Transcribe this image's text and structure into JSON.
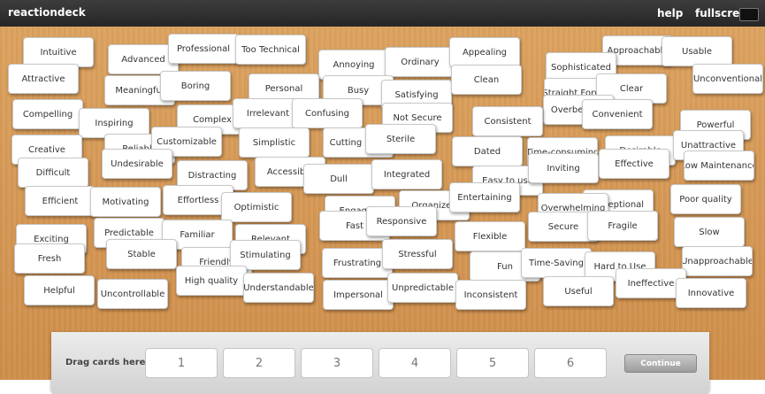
{
  "app": {
    "logo": "reactiondeck",
    "help_label": "help",
    "fullscreen_label": "fullscreen",
    "fullscreen_icon": "fullscreen-toggle-icon"
  },
  "cards": [
    "Intuitive",
    "Attractive",
    "Advanced",
    "Professional",
    "Too Technical",
    "Annoying",
    "Ordinary",
    "Appealing",
    "Approachable",
    "Usable",
    "Sophisticated",
    "Unconventional",
    "Meaningful",
    "Boring",
    "Busy",
    "Personal",
    "Satisfying",
    "Clean",
    "Straight Forward",
    "Clear",
    "Compelling",
    "Inspiring",
    "Complex",
    "Irrelevant",
    "Confusing",
    "Not Secure",
    "Overbearing",
    "Convenient",
    "Consistent",
    "Powerful",
    "Creative",
    "Reliable",
    "Customizable",
    "Simplistic",
    "Cutting edge",
    "Sterile",
    "Dated",
    "Time-consuming",
    "Desirable",
    "Unattractive",
    "Difficult",
    "Undesirable",
    "Distracting",
    "Accessible",
    "Dull",
    "Integrated",
    "Easy to use",
    "Inviting",
    "Effective",
    "Low Maintenance",
    "Efficient",
    "Motivating",
    "Effortless",
    "Optimistic",
    "Engaging",
    "Organized",
    "Entertaining",
    "Exceptional",
    "Overwhelming",
    "Poor quality",
    "Exciting",
    "Predictable",
    "Familiar",
    "Relevant",
    "Fast",
    "Responsive",
    "Flexible",
    "Secure",
    "Fragile",
    "Slow",
    "Fresh",
    "Stable",
    "Friendly",
    "Stimulating",
    "Frustrating",
    "Stressful",
    "Fun",
    "Time-Saving",
    "Hard to Use",
    "Unapproachable",
    "Helpful",
    "Uncontrollable",
    "High quality",
    "Understandable",
    "Impersonal",
    "Unpredictable",
    "Inconsistent",
    "Useful",
    "Ineffective",
    "Innovative"
  ],
  "tray": {
    "label": "Drag cards here:",
    "slots": [
      "1",
      "2",
      "3",
      "4",
      "5",
      "6"
    ],
    "continue_label": "Continue"
  }
}
